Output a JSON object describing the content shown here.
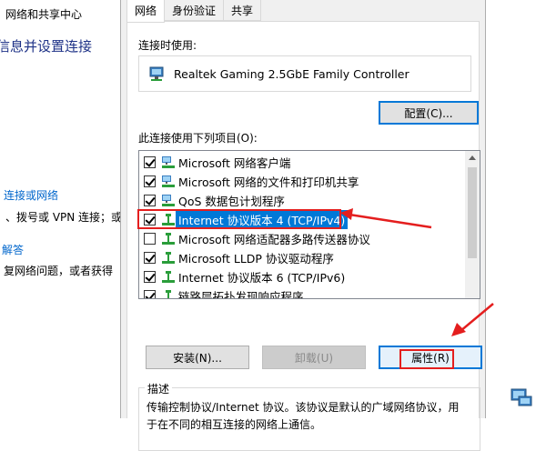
{
  "background_window": {
    "title": "网络和共享中心",
    "heading": "信息并设置连接",
    "link_new_connection": "连接或网络",
    "new_connection_desc": "、拨号或 VPN 连接；或",
    "link_troubleshoot": "解答",
    "troubleshoot_desc": "复网络问题，或者获得"
  },
  "dialog": {
    "tabs": [
      {
        "label": "网络"
      },
      {
        "label": "身份验证"
      },
      {
        "label": "共享"
      }
    ],
    "connect_using_label": "连接时使用:",
    "adapter_name": "Realtek Gaming 2.5GbE Family Controller",
    "configure_button": "配置(C)...",
    "items_label": "此连接使用下列项目(O):",
    "items": [
      {
        "label": "Microsoft 网络客户端",
        "checked": true,
        "icon": "network-client-icon"
      },
      {
        "label": "Microsoft 网络的文件和打印机共享",
        "checked": true,
        "icon": "file-printer-sharing-icon"
      },
      {
        "label": "QoS 数据包计划程序",
        "checked": true,
        "icon": "qos-icon"
      },
      {
        "label": "Internet 协议版本 4 (TCP/IPv4)",
        "checked": true,
        "icon": "protocol-icon",
        "selected": true
      },
      {
        "label": "Microsoft 网络适配器多路传送器协议",
        "checked": false,
        "icon": "protocol-icon"
      },
      {
        "label": "Microsoft LLDP 协议驱动程序",
        "checked": true,
        "icon": "protocol-icon"
      },
      {
        "label": "Internet 协议版本 6 (TCP/IPv6)",
        "checked": true,
        "icon": "protocol-icon"
      },
      {
        "label": "链路层拓扑发现响应程序",
        "checked": true,
        "icon": "protocol-icon"
      }
    ],
    "install_button": "安装(N)...",
    "uninstall_button": "卸载(U)",
    "properties_button": "属性(R)",
    "description_group": "描述",
    "description_text": "传输控制协议/Internet 协议。该协议是默认的广域网络协议，用于在不同的相互连接的网络上通信。"
  },
  "colors": {
    "selection": "#0078d7",
    "annotation": "#e41e1e",
    "link": "#0066cc"
  }
}
